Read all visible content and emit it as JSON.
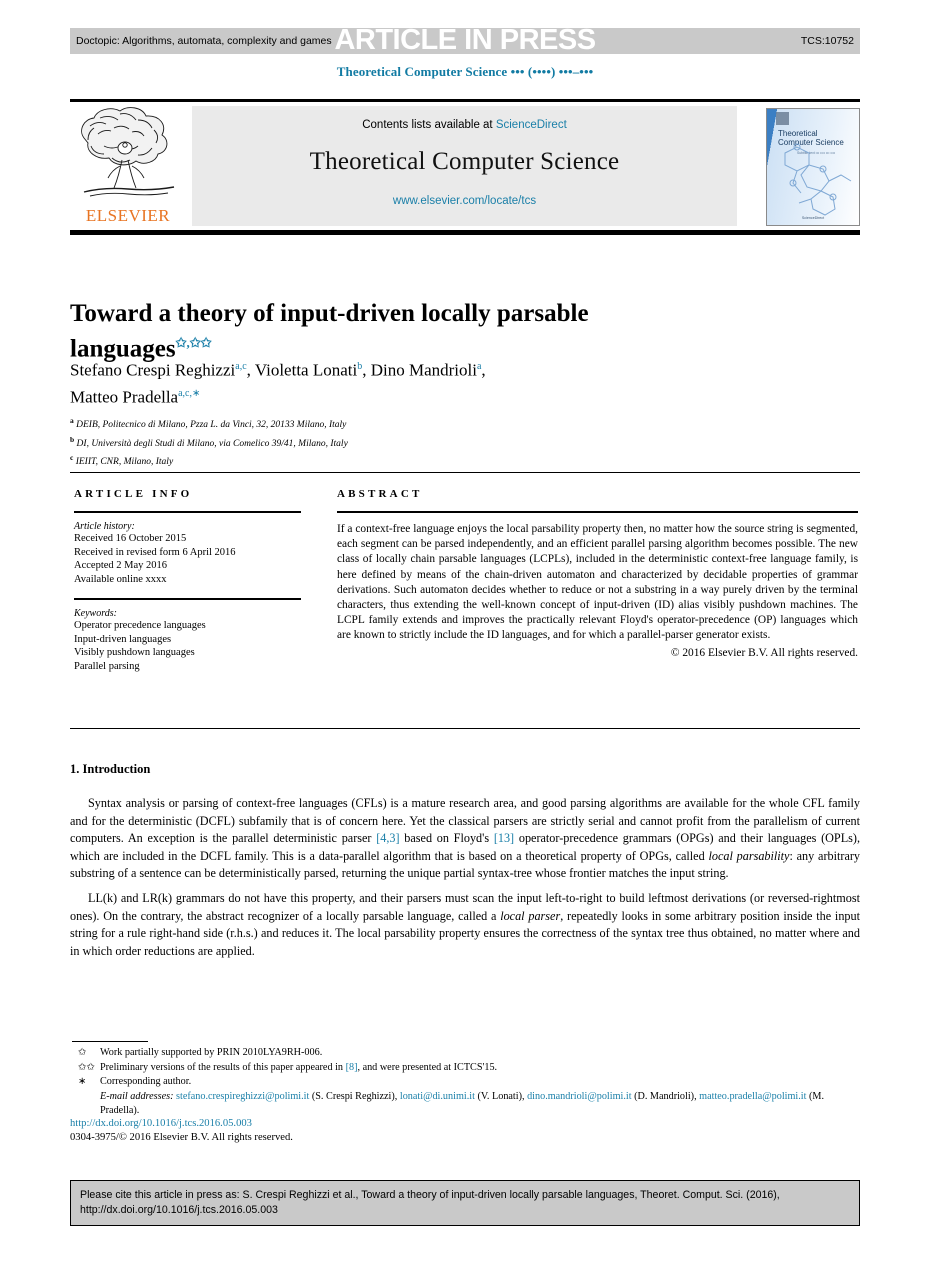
{
  "press_bar": {
    "doctopic": "Doctopic: Algorithms, automata, complexity and games",
    "stamp": "ARTICLE IN PRESS",
    "code": "TCS:10752"
  },
  "running_head": "Theoretical Computer Science ••• (••••) •••–•••",
  "masthead": {
    "publisher": "ELSEVIER",
    "contents_prefix": "Contents lists available at ",
    "contents_link": "ScienceDirect",
    "journal_name": "Theoretical Computer Science",
    "journal_url": "www.elsevier.com/locate/tcs",
    "cover_title_line1": "Theoretical",
    "cover_title_line2": "Computer Science",
    "cover_sub": "Subtitle text ••• •••• ••• ••••",
    "cover_footer": "ScienceDirect"
  },
  "article": {
    "title": "Toward a theory of input-driven locally parsable languages",
    "title_marks": "✩,✩✩",
    "authors_line1_a": "Stefano Crespi Reghizzi",
    "authors_mark1": "a,c",
    "authors_sep1": ", ",
    "authors_line1_b": "Violetta Lonati",
    "authors_mark2": "b",
    "authors_sep2": ", ",
    "authors_line1_c": "Dino Mandrioli",
    "authors_mark3": "a",
    "authors_sep3": ",",
    "authors_line2": "Matteo Pradella",
    "authors_mark4": "a,c,∗",
    "affiliations": [
      {
        "mark": "a",
        "text": "DEIB, Politecnico di Milano, Pzza L. da Vinci, 32, 20133 Milano, Italy"
      },
      {
        "mark": "b",
        "text": "DI, Università degli Studi di Milano, via Comelico 39/41, Milano, Italy"
      },
      {
        "mark": "c",
        "text": "IEIIT, CNR, Milano, Italy"
      }
    ]
  },
  "article_info": {
    "heading": "ARTICLE INFO",
    "history_label": "Article history:",
    "history": [
      "Received 16 October 2015",
      "Received in revised form 6 April 2016",
      "Accepted 2 May 2016",
      "Available online xxxx"
    ],
    "keywords_label": "Keywords:",
    "keywords": [
      "Operator precedence languages",
      "Input-driven languages",
      "Visibly pushdown languages",
      "Parallel parsing"
    ]
  },
  "abstract": {
    "heading": "ABSTRACT",
    "text": "If a context-free language enjoys the local parsability property then, no matter how the source string is segmented, each segment can be parsed independently, and an efficient parallel parsing algorithm becomes possible. The new class of locally chain parsable languages (LCPLs), included in the deterministic context-free language family, is here defined by means of the chain-driven automaton and characterized by decidable properties of grammar derivations. Such automaton decides whether to reduce or not a substring in a way purely driven by the terminal characters, thus extending the well-known concept of input-driven (ID) alias visibly pushdown machines. The LCPL family extends and improves the practically relevant Floyd's operator-precedence (OP) languages which are known to strictly include the ID languages, and for which a parallel-parser generator exists.",
    "copyright": "© 2016 Elsevier B.V. All rights reserved."
  },
  "body": {
    "section_title": "1. Introduction",
    "p1_pre": "Syntax analysis or parsing of context-free languages (CFLs) is a mature research area, and good parsing algorithms are available for the whole CFL family and for the deterministic (DCFL) subfamily that is of concern here. Yet the classical parsers are strictly serial and cannot profit from the parallelism of current computers. An exception is the parallel deterministic parser ",
    "p1_ref1": "[4,3]",
    "p1_mid1": " based on Floyd's ",
    "p1_ref2": "[13]",
    "p1_mid2": " operator-precedence grammars (OPGs) and their languages (OPLs), which are included in the DCFL family. This is a data-parallel algorithm that is based on a theoretical property of OPGs, called ",
    "p1_ital1": "local parsability",
    "p1_post": ": any arbitrary substring of a sentence can be deterministically parsed, returning the unique partial syntax-tree whose frontier matches the input string.",
    "p2_pre": "LL(k) and LR(k) grammars do not have this property, and their parsers must scan the input left-to-right to build leftmost derivations (or reversed-rightmost ones). On the contrary, the abstract recognizer of a locally parsable language, called a ",
    "p2_ital1": "local parser",
    "p2_post": ", repeatedly looks in some arbitrary position inside the input string for a rule right-hand side (r.h.s.) and reduces it. The local parsability property ensures the correctness of the syntax tree thus obtained, no matter where and in which order reductions are applied."
  },
  "footnotes": {
    "fn1_mark": "✩",
    "fn1_text": "Work partially supported by PRIN 2010LYA9RH-006.",
    "fn2_mark": "✩✩",
    "fn2_pre": "Preliminary versions of the results of this paper appeared in ",
    "fn2_ref": "[8]",
    "fn2_post": ", and were presented at ICTCS'15.",
    "fn3_mark": "∗",
    "fn3_text": "Corresponding author.",
    "email_label": "E-mail addresses:",
    "emails": [
      {
        "address": "stefano.crespireghizzi@polimi.it",
        "person": " (S. Crespi Reghizzi), "
      },
      {
        "address": "lonati@di.unimi.it",
        "person": " (V. Lonati), "
      },
      {
        "address": "dino.mandrioli@polimi.it",
        "person": " (D. Mandrioli), "
      },
      {
        "address": "matteo.pradella@polimi.it",
        "person": " (M. Pradella)."
      }
    ]
  },
  "doi_line": "http://dx.doi.org/10.1016/j.tcs.2016.05.003",
  "issn_line": "0304-3975/© 2016 Elsevier B.V. All rights reserved.",
  "cite_box": {
    "line1": "Please cite this article in press as: S. Crespi Reghizzi et al., Toward a theory of input-driven locally parsable languages, Theoret. Comput. Sci. (2016),",
    "line2": "http://dx.doi.org/10.1016/j.tcs.2016.05.003"
  },
  "colors": {
    "link": "#1a7fa8",
    "elsevier_orange": "#e87422",
    "press_bar": "#c9c9c9",
    "masthead_gray": "#eaeaea"
  }
}
